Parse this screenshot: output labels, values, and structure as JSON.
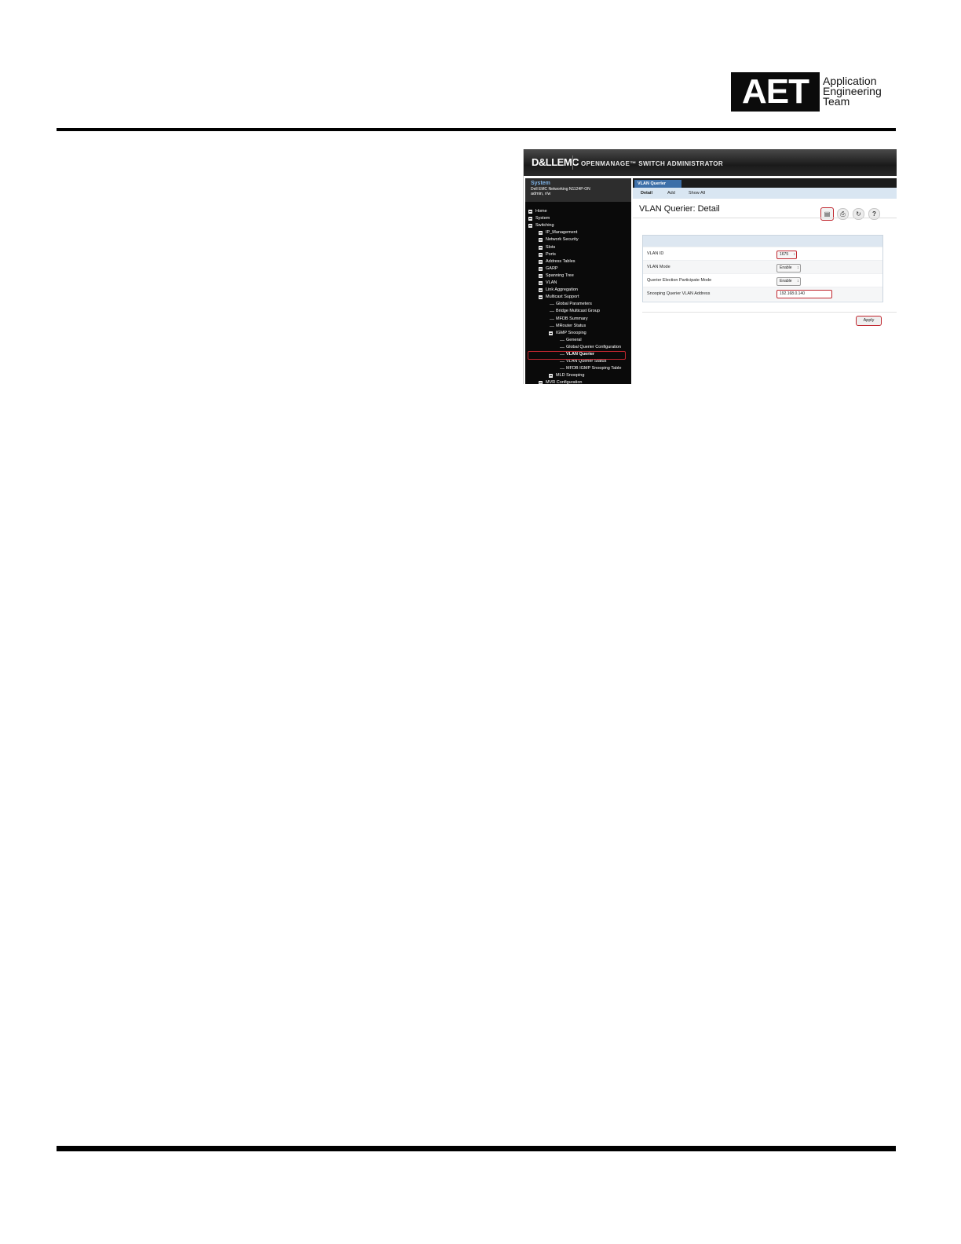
{
  "header": {
    "logo_letters": "AET",
    "logo_words": [
      "Application",
      "Engineering",
      "Team"
    ]
  },
  "screenshot": {
    "brand": "D&LLEMC",
    "app_title": "OPENMANAGE™ SWITCH ADMINISTRATOR",
    "nav": {
      "system_label": "System",
      "device": "Dell EMC Networking N1124P-ON",
      "user": "admin, r/w",
      "items": [
        {
          "label": "Home",
          "level": 0
        },
        {
          "label": "System",
          "level": 0
        },
        {
          "label": "Switching",
          "level": 0
        },
        {
          "label": "IP_Management",
          "level": 1
        },
        {
          "label": "Network Security",
          "level": 1
        },
        {
          "label": "Slots",
          "level": 1
        },
        {
          "label": "Ports",
          "level": 1
        },
        {
          "label": "Address Tables",
          "level": 1
        },
        {
          "label": "GARP",
          "level": 1
        },
        {
          "label": "Spanning Tree",
          "level": 1
        },
        {
          "label": "VLAN",
          "level": 1
        },
        {
          "label": "Link Aggregation",
          "level": 1
        },
        {
          "label": "Multicast Support",
          "level": 1
        },
        {
          "label": "Global Parameters",
          "level": 2
        },
        {
          "label": "Bridge Multicast Group",
          "level": 2
        },
        {
          "label": "MFDB Summary",
          "level": 2
        },
        {
          "label": "MRouter Status",
          "level": 2
        },
        {
          "label": "IGMP Snooping",
          "level": 2
        },
        {
          "label": "General",
          "level": 3
        },
        {
          "label": "Global Querier Configuration",
          "level": 3
        },
        {
          "label": "VLAN Querier",
          "level": 3
        },
        {
          "label": "VLAN Querier Status",
          "level": 3
        },
        {
          "label": "MFDB IGMP Snooping Table",
          "level": 3
        },
        {
          "label": "MLD Snooping",
          "level": 2
        },
        {
          "label": "MVR Configuration",
          "level": 1
        }
      ]
    },
    "tab": "VLAN Querier",
    "subtabs": [
      "Detail",
      "Add",
      "Show All"
    ],
    "page_title": "VLAN Querier: Detail",
    "toolbar_icons": [
      "save-icon",
      "print-icon",
      "refresh-icon",
      "help-icon"
    ],
    "form": {
      "rows": [
        {
          "label": "VLAN ID",
          "value": "1675"
        },
        {
          "label": "VLAN Mode",
          "value": "Enable"
        },
        {
          "label": "Querier Election Participate Mode",
          "value": "Enable"
        },
        {
          "label": "Snooping Querier VLAN Address",
          "value": "192.168.0.140"
        }
      ]
    },
    "apply_label": "Apply",
    "highlight_color": "#c0262e",
    "tab_color": "#3d6fa8"
  }
}
